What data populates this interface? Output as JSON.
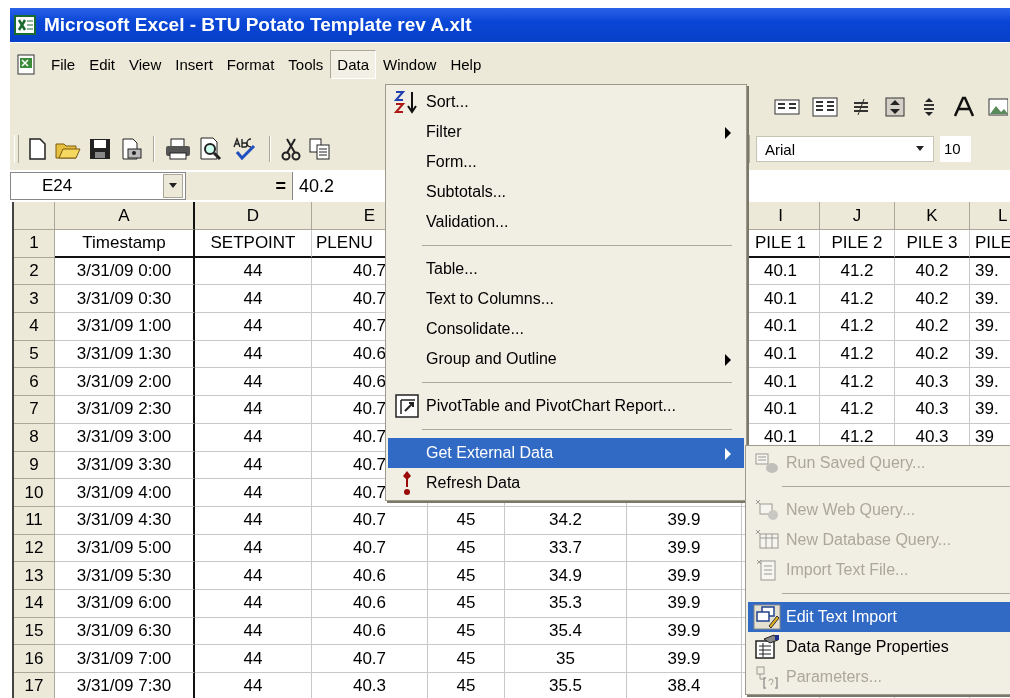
{
  "window": {
    "title": "Microsoft Excel - BTU Potato Template rev A.xlt"
  },
  "menu_bar": [
    {
      "label": "File",
      "selected": false
    },
    {
      "label": "Edit",
      "selected": false
    },
    {
      "label": "View",
      "selected": false
    },
    {
      "label": "Insert",
      "selected": false
    },
    {
      "label": "Format",
      "selected": false
    },
    {
      "label": "Tools",
      "selected": false
    },
    {
      "label": "Data",
      "selected": true
    },
    {
      "label": "Window",
      "selected": false
    },
    {
      "label": "Help",
      "selected": false
    }
  ],
  "formatting_toolbar": {
    "font": "Arial",
    "font_size": "10"
  },
  "formula_bar": {
    "cell": "E24",
    "equals": "=",
    "value": "40.2"
  },
  "sheet": {
    "columns": [
      "A",
      "D",
      "E",
      null,
      null,
      null,
      "I",
      "J",
      "K",
      "L"
    ],
    "rows": [
      {
        "number": "1",
        "cells": [
          "Timestamp",
          "SETPOINT",
          "PLENU",
          null,
          null,
          null,
          "PILE 1",
          "PILE 2",
          "PILE 3",
          "PILE"
        ]
      },
      {
        "number": "2",
        "cells": [
          "3/31/09 0:00",
          "44",
          "40.7",
          null,
          null,
          null,
          "40.1",
          "41.2",
          "40.2",
          "39."
        ]
      },
      {
        "number": "3",
        "cells": [
          "3/31/09 0:30",
          "44",
          "40.7",
          null,
          null,
          null,
          "40.1",
          "41.2",
          "40.2",
          "39."
        ]
      },
      {
        "number": "4",
        "cells": [
          "3/31/09 1:00",
          "44",
          "40.7",
          null,
          null,
          null,
          "40.1",
          "41.2",
          "40.2",
          "39."
        ]
      },
      {
        "number": "5",
        "cells": [
          "3/31/09 1:30",
          "44",
          "40.6",
          null,
          null,
          null,
          "40.1",
          "41.2",
          "40.2",
          "39."
        ]
      },
      {
        "number": "6",
        "cells": [
          "3/31/09 2:00",
          "44",
          "40.6",
          null,
          null,
          null,
          "40.1",
          "41.2",
          "40.3",
          "39."
        ]
      },
      {
        "number": "7",
        "cells": [
          "3/31/09 2:30",
          "44",
          "40.7",
          null,
          null,
          null,
          "40.1",
          "41.2",
          "40.3",
          "39."
        ]
      },
      {
        "number": "8",
        "cells": [
          "3/31/09 3:00",
          "44",
          "40.7",
          null,
          null,
          null,
          "40.1",
          "41.2",
          "40.3",
          "39"
        ]
      },
      {
        "number": "9",
        "cells": [
          "3/31/09 3:30",
          "44",
          "40.7",
          null,
          null,
          null,
          null,
          null,
          null,
          null
        ]
      },
      {
        "number": "10",
        "cells": [
          "3/31/09 4:00",
          "44",
          "40.7",
          null,
          null,
          null,
          null,
          null,
          null,
          null
        ]
      },
      {
        "number": "11",
        "cells": [
          "3/31/09 4:30",
          "44",
          "40.7",
          "45",
          "34.2",
          "39.9",
          null,
          null,
          null,
          null
        ]
      },
      {
        "number": "12",
        "cells": [
          "3/31/09 5:00",
          "44",
          "40.7",
          "45",
          "33.7",
          "39.9",
          null,
          null,
          null,
          null
        ]
      },
      {
        "number": "13",
        "cells": [
          "3/31/09 5:30",
          "44",
          "40.6",
          "45",
          "34.9",
          "39.9",
          null,
          null,
          null,
          null
        ]
      },
      {
        "number": "14",
        "cells": [
          "3/31/09 6:00",
          "44",
          "40.6",
          "45",
          "35.3",
          "39.9",
          null,
          null,
          null,
          null
        ]
      },
      {
        "number": "15",
        "cells": [
          "3/31/09 6:30",
          "44",
          "40.6",
          "45",
          "35.4",
          "39.9",
          null,
          null,
          null,
          null
        ]
      },
      {
        "number": "16",
        "cells": [
          "3/31/09 7:00",
          "44",
          "40.7",
          "45",
          "35",
          "39.9",
          null,
          null,
          null,
          null
        ]
      },
      {
        "number": "17",
        "cells": [
          "3/31/09 7:30",
          "44",
          "40.3",
          "45",
          "35.5",
          "38.4",
          null,
          null,
          null,
          null
        ]
      }
    ]
  },
  "data_menu": {
    "items": [
      {
        "kind": "item",
        "label": "Sort...",
        "submenu": false,
        "selected": false
      },
      {
        "kind": "item",
        "label": "Filter",
        "submenu": true,
        "selected": false
      },
      {
        "kind": "item",
        "label": "Form...",
        "submenu": false,
        "selected": false
      },
      {
        "kind": "item",
        "label": "Subtotals...",
        "submenu": false,
        "selected": false
      },
      {
        "kind": "item",
        "label": "Validation...",
        "submenu": false,
        "selected": false
      },
      {
        "kind": "separator"
      },
      {
        "kind": "item",
        "label": "Table...",
        "submenu": false,
        "selected": false
      },
      {
        "kind": "item",
        "label": "Text to Columns...",
        "submenu": false,
        "selected": false
      },
      {
        "kind": "item",
        "label": "Consolidate...",
        "submenu": false,
        "selected": false
      },
      {
        "kind": "item",
        "label": "Group and Outline",
        "submenu": true,
        "selected": false
      },
      {
        "kind": "separator"
      },
      {
        "kind": "item",
        "label": "PivotTable and PivotChart Report...",
        "submenu": false,
        "selected": false
      },
      {
        "kind": "separator"
      },
      {
        "kind": "item",
        "label": "Get External Data",
        "submenu": true,
        "selected": true
      },
      {
        "kind": "item",
        "label": "Refresh Data",
        "submenu": false,
        "selected": false
      }
    ]
  },
  "external_data_menu": {
    "items": [
      {
        "kind": "item",
        "label": "Run Saved Query...",
        "disabled": true,
        "selected": false
      },
      {
        "kind": "separator"
      },
      {
        "kind": "item",
        "label": "New Web Query...",
        "disabled": true,
        "selected": false
      },
      {
        "kind": "item",
        "label": "New Database Query...",
        "disabled": true,
        "selected": false
      },
      {
        "kind": "item",
        "label": "Import Text File...",
        "disabled": true,
        "selected": false
      },
      {
        "kind": "separator"
      },
      {
        "kind": "item",
        "label": "Edit Text Import",
        "disabled": false,
        "selected": true
      },
      {
        "kind": "item",
        "label": "Data Range Properties",
        "disabled": false,
        "selected": false
      },
      {
        "kind": "item",
        "label": "Parameters...",
        "disabled": true,
        "selected": false
      }
    ]
  }
}
